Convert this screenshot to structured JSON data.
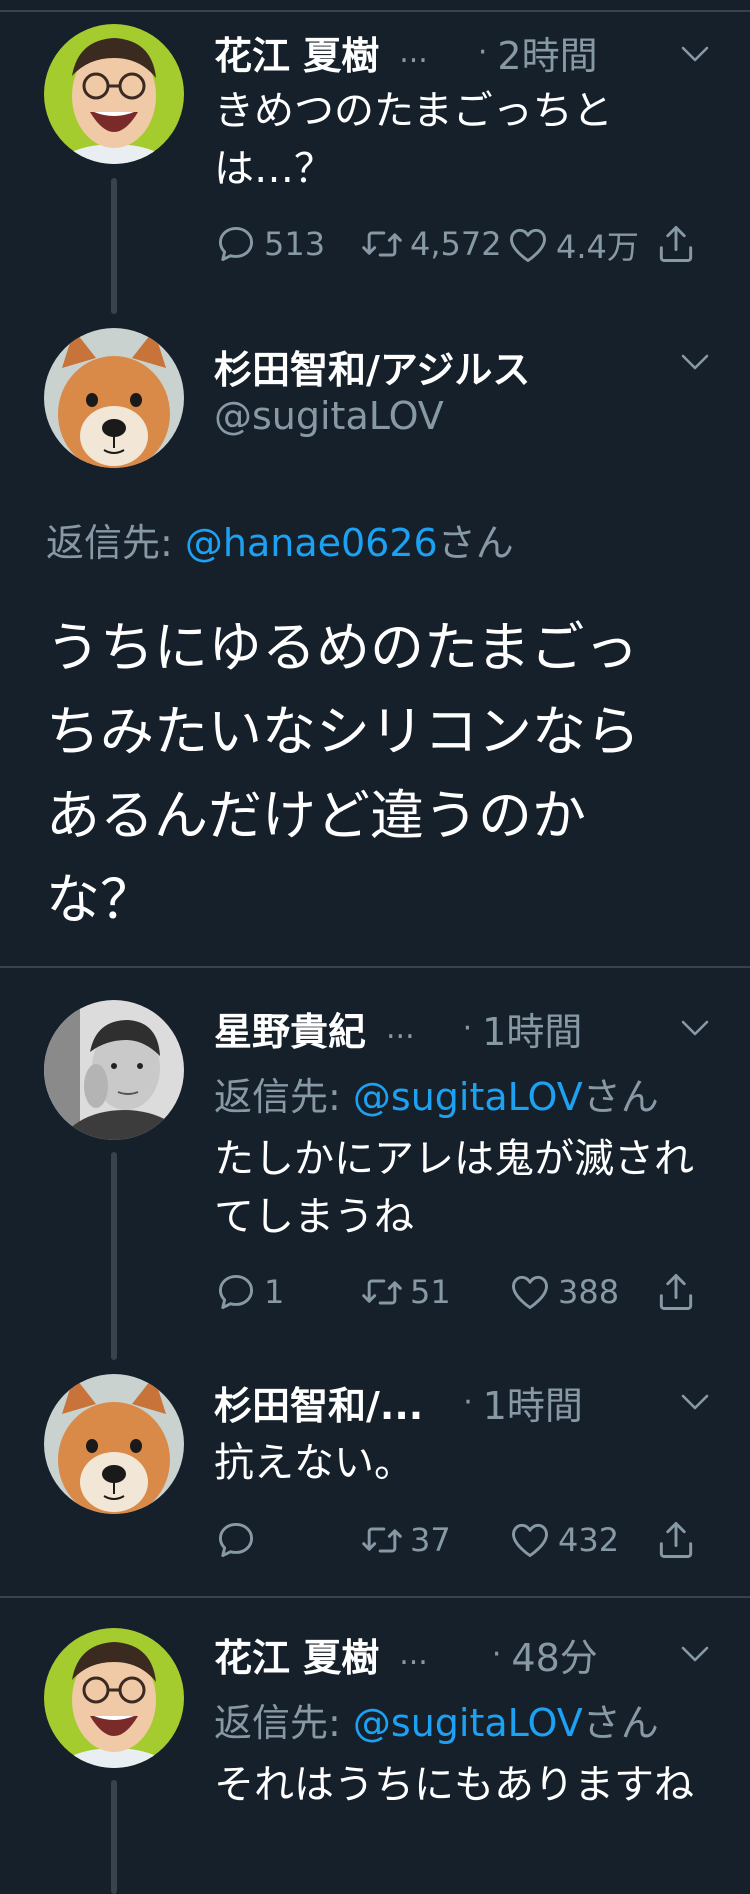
{
  "tweets": [
    {
      "name": "花江 夏樹",
      "name_ellipsis": "...",
      "time": "2時間",
      "text": "きめつのたまごっちとは…？",
      "reply_count": "513",
      "retweet_count": "4,572",
      "like_count": "4.4万"
    },
    {
      "name": "杉田智和/アジルス",
      "handle": "@sugitaLOV",
      "reply_prefix": "返信先: ",
      "reply_mention": "@hanae0626",
      "reply_suffix": "さん",
      "text": "うちにゆるめのたまごっちみたいなシリコンならあるんだけど違うのかな？"
    },
    {
      "name": "星野貴紀",
      "name_ellipsis": "...",
      "time": "1時間",
      "reply_prefix": "返信先: ",
      "reply_mention": "@sugitaLOV",
      "reply_suffix": "さん",
      "text": "たしかにアレは鬼が滅されてしまうね",
      "reply_count": "1",
      "retweet_count": "51",
      "like_count": "388"
    },
    {
      "name": "杉田智和/...",
      "time": "1時間",
      "text": "抗えない。",
      "reply_count": "",
      "retweet_count": "37",
      "like_count": "432"
    },
    {
      "name": "花江 夏樹",
      "name_ellipsis": "...",
      "time": "48分",
      "reply_prefix": "返信先: ",
      "reply_mention": "@sugitaLOV",
      "reply_suffix": "さん",
      "text": "それはうちにもありますね"
    }
  ],
  "dot": "·",
  "colors": {
    "background": "#15202b",
    "muted": "#8899a6",
    "accent": "#1da1f2",
    "divider": "#38444d"
  },
  "icons": [
    "reply-icon",
    "retweet-icon",
    "like-icon",
    "share-icon",
    "chevron-down-icon"
  ]
}
